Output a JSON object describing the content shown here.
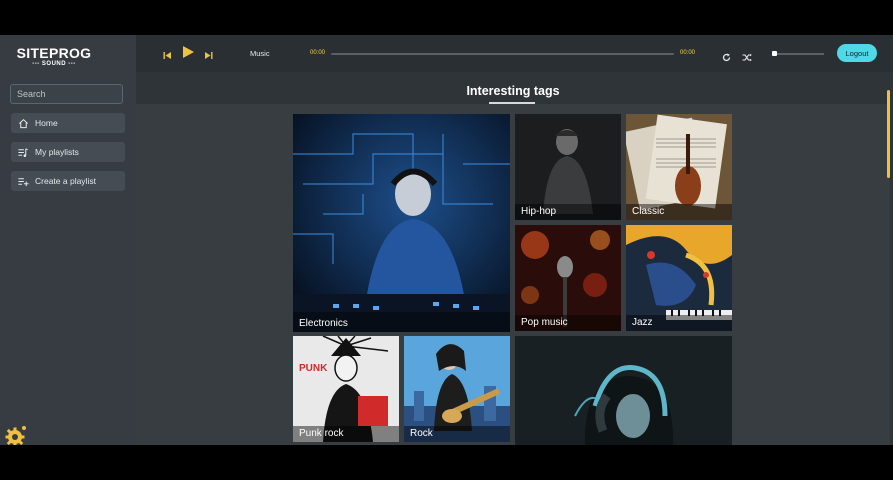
{
  "app": {
    "logo_line1": "SITEPROG",
    "logo_line2": "--- SOUND ---"
  },
  "sidebar": {
    "search_placeholder": "Search",
    "items": [
      {
        "label": "Home",
        "icon": "home-icon"
      },
      {
        "label": "My playlists",
        "icon": "playlist-icon"
      },
      {
        "label": "Create a playlist",
        "icon": "add-playlist-icon"
      }
    ],
    "settings_icon": "gear-icon"
  },
  "player": {
    "track_label": "Music",
    "current_time": "00:00",
    "total_time": "00:00",
    "progress": 0,
    "volume": 0,
    "logout_label": "Logout",
    "colors": {
      "accent": "#4fd8e6",
      "time": "#f2d44c"
    }
  },
  "main": {
    "title": "Interesting tags",
    "tags": [
      {
        "label": "Electronics"
      },
      {
        "label": "Hip-hop"
      },
      {
        "label": "Classic"
      },
      {
        "label": "Pop music"
      },
      {
        "label": "Jazz"
      },
      {
        "label": "Punk rock"
      },
      {
        "label": "Rock"
      },
      {
        "label": ""
      }
    ]
  }
}
